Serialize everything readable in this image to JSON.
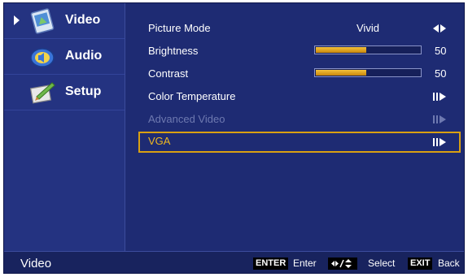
{
  "sidebar": {
    "items": [
      {
        "label": "Video",
        "icon": "video-icon",
        "active": true
      },
      {
        "label": "Audio",
        "icon": "audio-icon"
      },
      {
        "label": "Setup",
        "icon": "setup-icon"
      }
    ]
  },
  "menu": {
    "rows": [
      {
        "label": "Picture Mode",
        "value": "Vivid",
        "control": "left-right-arrows-icon"
      },
      {
        "label": "Brightness",
        "value": "50",
        "level": 0.5
      },
      {
        "label": "Contrast",
        "value": "50",
        "level": 0.5
      },
      {
        "label": "Color Temperature",
        "control": "enter-submenu-icon"
      },
      {
        "label": "Advanced Video",
        "control": "enter-submenu-icon",
        "disabled": true
      },
      {
        "label": "VGA",
        "control": "enter-submenu-icon",
        "selected": true
      }
    ]
  },
  "footer": {
    "title": "Video",
    "enter_key": "ENTER",
    "enter_text": "Enter",
    "select_text": "Select",
    "exit_key": "EXIT",
    "exit_text": "Back"
  },
  "colors": {
    "background": "#1e2b73",
    "selection": "#d9a012",
    "bar_fill": "#e6a820",
    "disabled_text": "#6e79b0"
  }
}
